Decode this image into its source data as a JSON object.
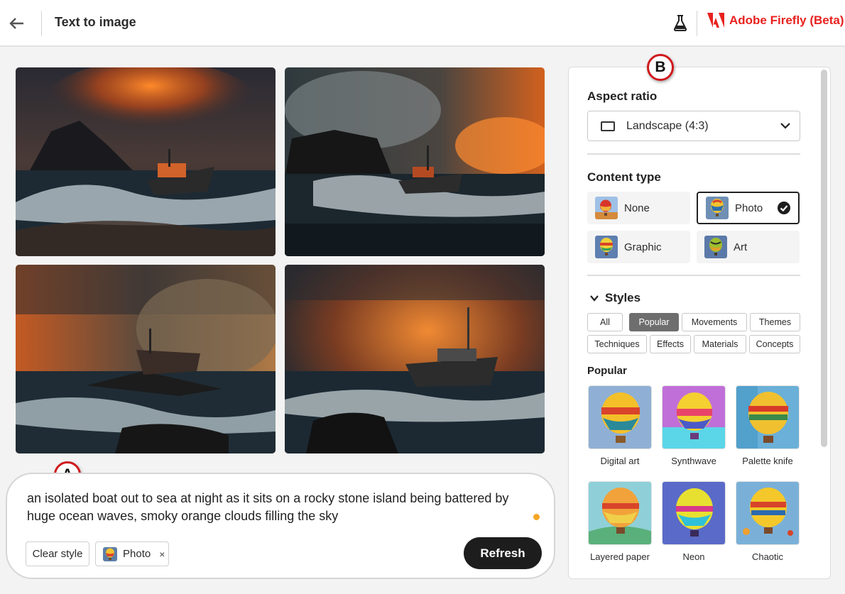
{
  "header": {
    "title": "Text to image",
    "brand": "Adobe Firefly (Beta)"
  },
  "callouts": {
    "a": "A",
    "b": "B"
  },
  "prompt": {
    "text": "an isolated boat out to sea at night as it sits on a rocky stone island being battered by huge ocean waves, smoky orange clouds filling the sky",
    "clear_style": "Clear style",
    "style_chip": "Photo",
    "remove_glyph": "×",
    "refresh": "Refresh"
  },
  "panel": {
    "aspect": {
      "title": "Aspect ratio",
      "value": "Landscape (4:3)"
    },
    "content_type": {
      "title": "Content type",
      "options": [
        {
          "label": "None",
          "selected": false
        },
        {
          "label": "Photo",
          "selected": true
        },
        {
          "label": "Graphic",
          "selected": false
        },
        {
          "label": "Art",
          "selected": false
        }
      ]
    },
    "styles": {
      "title": "Styles",
      "tags": [
        "All",
        "Popular",
        "Movements",
        "Themes",
        "Techniques",
        "Effects",
        "Materials",
        "Concepts"
      ],
      "active_tag": "Popular",
      "popular_title": "Popular",
      "items": [
        "Digital art",
        "Synthwave",
        "Palette knife",
        "Layered paper",
        "Neon",
        "Chaotic"
      ]
    }
  },
  "colors": {
    "brand": "#e8211e",
    "callout_border": "#d0181d",
    "indicator": "#f5a623"
  }
}
